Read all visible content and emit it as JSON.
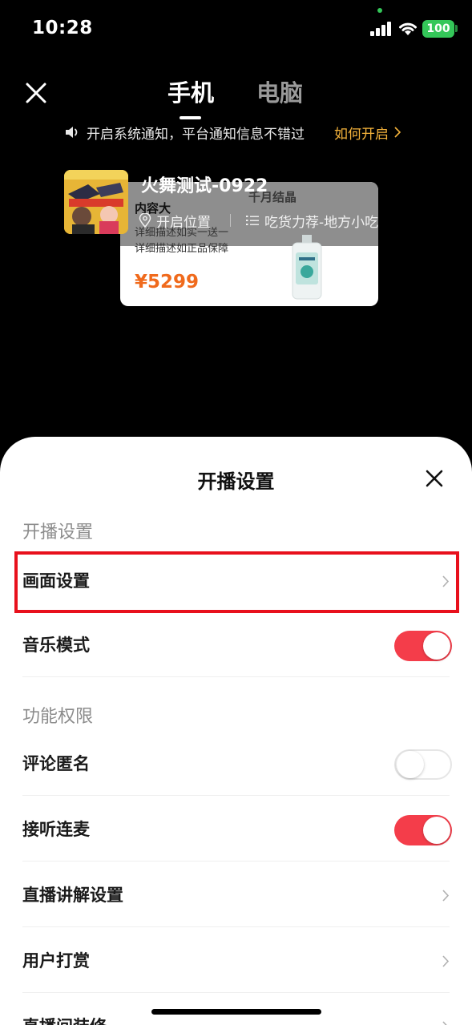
{
  "status_bar": {
    "time": "10:28",
    "battery": "100"
  },
  "nav": {
    "tabs": [
      {
        "label": "手机"
      },
      {
        "label": "电脑"
      }
    ]
  },
  "notice": {
    "text": "开启系统通知，平台通知信息不错过",
    "link": "如何开启"
  },
  "preview": {
    "room_title": "火舞测试-0922",
    "location": "开启位置",
    "category": "吃货力荐-地方小吃",
    "product": {
      "brand": "千月结晶",
      "title": "内容大",
      "desc_line1": "详细描述如实一送一",
      "desc_line2": "详细描述如正品保障",
      "price": "¥5299"
    }
  },
  "sheet": {
    "title": "开播设置",
    "sections": [
      {
        "label": "开播设置"
      },
      {
        "label": "功能权限"
      }
    ],
    "rows": {
      "picture_settings": "画面设置",
      "music_mode": "音乐模式",
      "anonymous_comment": "评论匿名",
      "answer_connect": "接听连麦",
      "live_explain": "直播讲解设置",
      "user_reward": "用户打赏",
      "room_decor": "直播间装修"
    },
    "toggles": {
      "music_mode": true,
      "anonymous_comment": false,
      "answer_connect": true
    }
  },
  "colors": {
    "accent_red": "#f43d4a",
    "link_orange": "#f5b33b",
    "price_orange": "#f06a1c",
    "highlight_red": "#e8101c"
  }
}
